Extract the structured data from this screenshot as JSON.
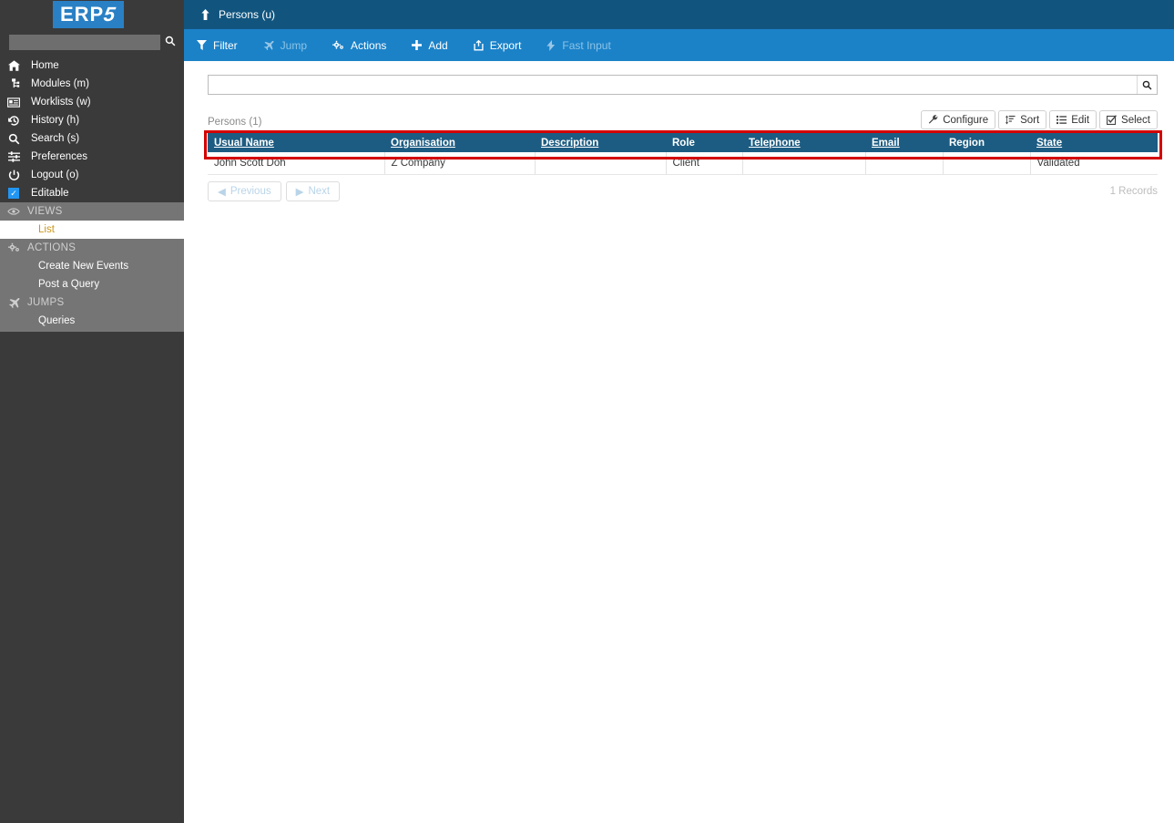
{
  "brand": {
    "logo_text_main": "ERP",
    "logo_text_accent": "5",
    "logo_bg": "#2980c4"
  },
  "sidebar": {
    "search_placeholder": "",
    "search_value": "",
    "search_icon": "search-icon",
    "items": [
      {
        "label": "Home",
        "icon": "home-icon"
      },
      {
        "label": "Modules (m)",
        "icon": "sitemap-icon"
      },
      {
        "label": "Worklists (w)",
        "icon": "list-alt-icon"
      },
      {
        "label": "History (h)",
        "icon": "history-icon"
      },
      {
        "label": "Search (s)",
        "icon": "search-icon"
      },
      {
        "label": "Preferences",
        "icon": "sliders-icon"
      },
      {
        "label": "Logout (o)",
        "icon": "power-icon"
      },
      {
        "label": "Editable",
        "icon": "checkbox-checked-icon"
      }
    ],
    "sections": [
      {
        "heading": "VIEWS",
        "heading_icon": "eye-icon",
        "links": [
          {
            "label": "List",
            "active": true
          }
        ]
      },
      {
        "heading": "ACTIONS",
        "heading_icon": "gears-icon",
        "links": [
          {
            "label": "Create New Events",
            "active": false
          },
          {
            "label": "Post a Query",
            "active": false
          }
        ]
      },
      {
        "heading": "JUMPS",
        "heading_icon": "plane-icon",
        "links": [
          {
            "label": "Queries",
            "active": false
          }
        ]
      }
    ]
  },
  "topbar": {
    "breadcrumb": "Persons (u)",
    "icon": "arrow-up-icon",
    "bg": "#11557f"
  },
  "actionbar": {
    "bg": "#1b82c8",
    "items": [
      {
        "label": "Filter",
        "icon": "filter-icon",
        "disabled": false
      },
      {
        "label": "Jump",
        "icon": "plane-icon",
        "disabled": true
      },
      {
        "label": "Actions",
        "icon": "gears-icon",
        "disabled": false
      },
      {
        "label": "Add",
        "icon": "plus-icon",
        "disabled": false
      },
      {
        "label": "Export",
        "icon": "export-icon",
        "disabled": false
      },
      {
        "label": "Fast Input",
        "icon": "bolt-icon",
        "disabled": true
      }
    ]
  },
  "search": {
    "value": "",
    "placeholder": "",
    "button_icon": "search-icon"
  },
  "listing": {
    "title": "Persons (1)",
    "toolbar": [
      {
        "label": "Configure",
        "icon": "wrench-icon"
      },
      {
        "label": "Sort",
        "icon": "sort-icon"
      },
      {
        "label": "Edit",
        "icon": "list-icon"
      },
      {
        "label": "Select",
        "icon": "checkbox-icon"
      }
    ],
    "columns": [
      {
        "label": "Usual Name",
        "sortable": true
      },
      {
        "label": "Organisation",
        "sortable": true
      },
      {
        "label": "Description",
        "sortable": true
      },
      {
        "label": "Role",
        "sortable": false
      },
      {
        "label": "Telephone",
        "sortable": true
      },
      {
        "label": "Email",
        "sortable": true
      },
      {
        "label": "Region",
        "sortable": false
      },
      {
        "label": "State",
        "sortable": true
      }
    ],
    "rows": [
      {
        "usual_name": "John Scott Doh",
        "organisation": "Z Company",
        "description": "",
        "role": "Client",
        "telephone": "",
        "email": "",
        "region": "",
        "state": "Validated",
        "highlighted": true
      }
    ],
    "highlight_color": "#d40000",
    "pager": {
      "previous_label": "Previous",
      "next_label": "Next",
      "previous_icon": "caret-left-icon",
      "next_icon": "caret-right-icon",
      "previous_disabled": true,
      "next_disabled": true
    },
    "records_label": "1 Records"
  }
}
